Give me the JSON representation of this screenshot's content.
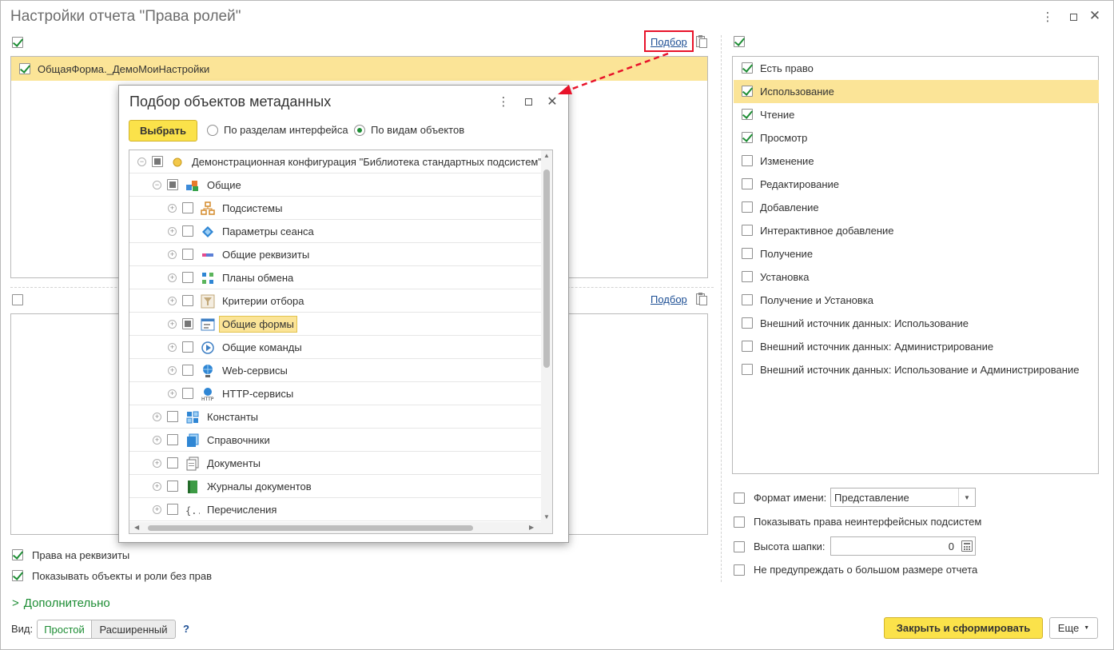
{
  "window": {
    "title": "Настройки отчета \"Права ролей\""
  },
  "objects": {
    "podbor": "Подбор",
    "items": [
      {
        "label": "ОбщаяФорма._ДемоМоиНастройки",
        "checked": true
      }
    ]
  },
  "roles": {
    "podbor": "Подбор"
  },
  "rights": {
    "items": [
      {
        "label": "Есть право",
        "checked": true
      },
      {
        "label": "Использование",
        "checked": true,
        "highlighted": true
      },
      {
        "label": "Чтение",
        "checked": true
      },
      {
        "label": "Просмотр",
        "checked": true
      },
      {
        "label": "Изменение",
        "checked": false
      },
      {
        "label": "Редактирование",
        "checked": false
      },
      {
        "label": "Добавление",
        "checked": false
      },
      {
        "label": "Интерактивное добавление",
        "checked": false
      },
      {
        "label": "Получение",
        "checked": false
      },
      {
        "label": "Установка",
        "checked": false
      },
      {
        "label": "Получение и Установка",
        "checked": false
      },
      {
        "label": "Внешний источник данных: Использование",
        "checked": false
      },
      {
        "label": "Внешний источник данных: Администрирование",
        "checked": false
      },
      {
        "label": "Внешний источник данных: Использование и Администрирование",
        "checked": false
      }
    ]
  },
  "options": {
    "name_format_label": "Формат имени:",
    "name_format_value": "Представление",
    "show_noninterface": "Показывать права неинтерфейсных подсистем",
    "header_height_label": "Высота шапки:",
    "header_height_value": "0",
    "no_warn": "Не предупреждать о большом размере отчета"
  },
  "bottom": {
    "attr_rights": "Права на реквизиты",
    "show_without_rights": "Показывать объекты и роли без прав",
    "additional": "Дополнительно",
    "view_label": "Вид:",
    "view_simple": "Простой",
    "view_extended": "Расширенный",
    "help": "?",
    "close_build": "Закрыть и сформировать",
    "more": "Еще"
  },
  "dialog": {
    "title": "Подбор объектов метаданных",
    "select_button": "Выбрать",
    "radio_sections": "По разделам интерфейса",
    "radio_types": "По видам объектов",
    "tree": [
      {
        "label": "Демонстрационная конфигурация \"Библиотека стандартных подсистем\",",
        "level": 0,
        "expanded": true,
        "state": "partial",
        "icon": "config-icon"
      },
      {
        "label": "Общие",
        "level": 1,
        "expanded": true,
        "state": "partial",
        "icon": "common-icon"
      },
      {
        "label": "Подсистемы",
        "level": 2,
        "expanded": false,
        "state": "none",
        "icon": "subsystems-icon"
      },
      {
        "label": "Параметры сеанса",
        "level": 2,
        "expanded": false,
        "state": "none",
        "icon": "session-params-icon"
      },
      {
        "label": "Общие реквизиты",
        "level": 2,
        "expanded": false,
        "state": "none",
        "icon": "common-attributes-icon"
      },
      {
        "label": "Планы обмена",
        "level": 2,
        "expanded": false,
        "state": "none",
        "icon": "exchange-plans-icon"
      },
      {
        "label": "Критерии отбора",
        "level": 2,
        "expanded": false,
        "state": "none",
        "icon": "filter-criteria-icon"
      },
      {
        "label": "Общие формы",
        "level": 2,
        "expanded": false,
        "state": "partial",
        "icon": "common-forms-icon",
        "selected": true
      },
      {
        "label": "Общие команды",
        "level": 2,
        "expanded": false,
        "state": "none",
        "icon": "common-commands-icon"
      },
      {
        "label": "Web-сервисы",
        "level": 2,
        "expanded": false,
        "state": "none",
        "icon": "web-services-icon"
      },
      {
        "label": "HTTP-сервисы",
        "level": 2,
        "expanded": false,
        "state": "none",
        "icon": "http-services-icon"
      },
      {
        "label": "Константы",
        "level": 1,
        "expanded": false,
        "state": "none",
        "icon": "constants-icon"
      },
      {
        "label": "Справочники",
        "level": 1,
        "expanded": false,
        "state": "none",
        "icon": "catalogs-icon"
      },
      {
        "label": "Документы",
        "level": 1,
        "expanded": false,
        "state": "none",
        "icon": "documents-icon"
      },
      {
        "label": "Журналы документов",
        "level": 1,
        "expanded": false,
        "state": "none",
        "icon": "journals-icon"
      },
      {
        "label": "Перечисления",
        "level": 1,
        "expanded": false,
        "state": "none",
        "icon": "enums-icon"
      }
    ]
  },
  "colors": {
    "accent_green": "#1d8d34",
    "highlight": "#fbe497",
    "primary_button": "#fbe24a",
    "link": "#1c4e94",
    "annotation_red": "#e8132a"
  }
}
